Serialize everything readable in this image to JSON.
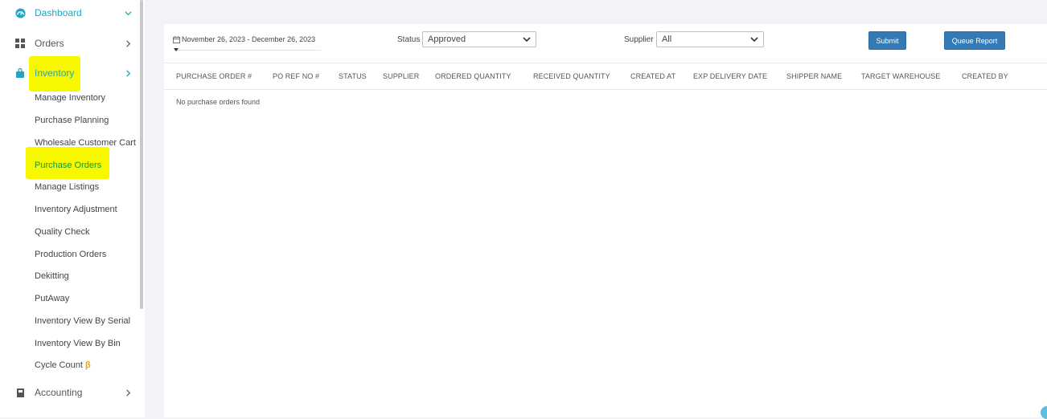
{
  "sidebar": {
    "items": [
      {
        "label": "Dashboard",
        "icon": "dashboard-gauge-icon"
      },
      {
        "label": "Orders",
        "icon": "grid-icon"
      },
      {
        "label": "Inventory",
        "icon": "shopping-bag-icon"
      },
      {
        "label": "Accounting",
        "icon": "ledger-icon"
      }
    ],
    "inventory_sub": [
      "Manage Inventory",
      "Purchase Planning",
      "Wholesale Customer Cart",
      "Purchase Orders",
      "Manage Listings",
      "Inventory Adjustment",
      "Quality Check",
      "Production Orders",
      "Dekitting",
      "PutAway",
      "Inventory View By Serial",
      "Inventory View By Bin",
      "Cycle Count"
    ],
    "beta_symbol": "β",
    "active_sub": "Purchase Orders"
  },
  "filters": {
    "date_range": "November 26, 2023 - December 26, 2023",
    "status_label": "Status",
    "status_value": "Approved",
    "supplier_label": "Supplier",
    "supplier_value": "All",
    "submit_label": "Submit",
    "queue_report_label": "Queue Report"
  },
  "table": {
    "columns": [
      "PURCHASE ORDER #",
      "PO REF NO #",
      "STATUS",
      "SUPPLIER",
      "ORDERED QUANTITY",
      "RECEIVED QUANTITY",
      "CREATED AT",
      "EXP DELIVERY DATE",
      "SHIPPER NAME",
      "TARGET WAREHOUSE",
      "CREATED BY"
    ],
    "empty_message": "No purchase orders found"
  },
  "colors": {
    "accent_teal": "#1fa7c2",
    "active_green": "#0a9d3a",
    "highlight_yellow": "#f7f700",
    "button_blue": "#337ab7",
    "beta_orange": "#f0a500"
  }
}
